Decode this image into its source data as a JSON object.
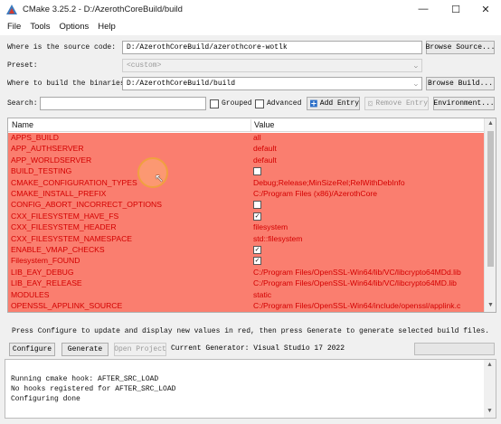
{
  "window": {
    "title": "CMake 3.25.2 - D:/AzerothCoreBuild/build",
    "minimize": "—",
    "maximize": "☐",
    "close": "✕"
  },
  "menu": [
    "File",
    "Tools",
    "Options",
    "Help"
  ],
  "source": {
    "label": "Where is the source code:",
    "value": "D:/AzerothCoreBuild/azerothcore-wotlk",
    "browse": "Browse Source..."
  },
  "preset": {
    "label": "Preset:",
    "value": "<custom>"
  },
  "build": {
    "label": "Where to build the binaries:",
    "value": "D:/AzerothCoreBuild/build",
    "browse": "Browse Build..."
  },
  "search": {
    "label": "Search:",
    "value": "",
    "grouped": "Grouped",
    "advanced": "Advanced",
    "add_entry": "Add Entry",
    "remove_entry": "Remove Entry",
    "environment": "Environment..."
  },
  "table": {
    "col_name": "Name",
    "col_value": "Value",
    "rows": [
      {
        "name": "APPS_BUILD",
        "value": "all"
      },
      {
        "name": "APP_AUTHSERVER",
        "value": "default"
      },
      {
        "name": "APP_WORLDSERVER",
        "value": "default"
      },
      {
        "name": "BUILD_TESTING",
        "value": "",
        "checkbox": true,
        "checked": false
      },
      {
        "name": "CMAKE_CONFIGURATION_TYPES",
        "value": "Debug;Release;MinSizeRel;RelWithDebInfo"
      },
      {
        "name": "CMAKE_INSTALL_PREFIX",
        "value": "C:/Program Files (x86)/AzerothCore"
      },
      {
        "name": "CONFIG_ABORT_INCORRECT_OPTIONS",
        "value": "",
        "checkbox": true,
        "checked": false
      },
      {
        "name": "CXX_FILESYSTEM_HAVE_FS",
        "value": "",
        "checkbox": true,
        "checked": true
      },
      {
        "name": "CXX_FILESYSTEM_HEADER",
        "value": "filesystem"
      },
      {
        "name": "CXX_FILESYSTEM_NAMESPACE",
        "value": "std::filesystem"
      },
      {
        "name": "ENABLE_VMAP_CHECKS",
        "value": "",
        "checkbox": true,
        "checked": true
      },
      {
        "name": "Filesystem_FOUND",
        "value": "",
        "checkbox": true,
        "checked": true
      },
      {
        "name": "LIB_EAY_DEBUG",
        "value": "C:/Program Files/OpenSSL-Win64/lib/VC/libcrypto64MDd.lib"
      },
      {
        "name": "LIB_EAY_RELEASE",
        "value": "C:/Program Files/OpenSSL-Win64/lib/VC/libcrypto64MD.lib"
      },
      {
        "name": "MODULES",
        "value": "static"
      },
      {
        "name": "OPENSSL_APPLINK_SOURCE",
        "value": "C:/Program Files/OpenSSL-Win64/include/openssl/applink.c"
      }
    ]
  },
  "hint": "Press Configure to update and display new values in red, then press Generate to generate selected build files.",
  "actions": {
    "configure": "Configure",
    "generate": "Generate",
    "open_project": "Open Project",
    "generator": "Current Generator: Visual Studio 17 2022"
  },
  "output": [
    "Running cmake hook: AFTER_SRC_LOAD",
    "No hooks registered for AFTER_SRC_LOAD",
    "Configuring done"
  ],
  "colors": {
    "changed_row_bg": "#fa7e6f",
    "changed_row_text": "#d30000"
  }
}
